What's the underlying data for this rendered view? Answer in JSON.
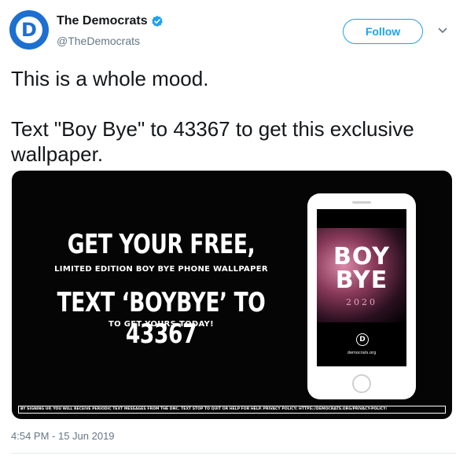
{
  "author": {
    "display_name": "The Democrats",
    "handle": "@TheDemocrats",
    "avatar_letter": "D",
    "verified": true
  },
  "actions": {
    "follow_label": "Follow"
  },
  "tweet": {
    "line1": "This is a whole mood.",
    "line2": "Text \"Boy Bye\" to 43367 to get this exclusive wallpaper."
  },
  "media": {
    "headline1": "GET YOUR FREE,",
    "subline1": "LIMITED EDITION BOY BYE PHONE WALLPAPER",
    "headline2": "TEXT ‘BOYBYE’ TO 43367",
    "subline2": "TO GET YOURS TODAY!",
    "phone_screen": {
      "title_line1": "BOY",
      "title_line2": "BYE",
      "year": "2020",
      "logo_letter": "D",
      "url": "democrats.org"
    },
    "disclaimer": "BY SIGNING UP, YOU WILL RECEIVE PERIODIC TEXT MESSAGES FROM THE DNC. TEXT STOP TO QUIT OR HELP FOR HELP. PRIVACY POLICY: HTTPS://DEMOCRATS.ORG/PRIVACY-POLICY/"
  },
  "timestamp": "4:54 PM - 15 Jun 2019",
  "colors": {
    "accent": "#1da1f2",
    "brand_blue": "#1d6fd0",
    "secondary_text": "#657786"
  },
  "icons": {
    "verified": "verified-badge-icon",
    "more": "chevron-down-icon"
  }
}
